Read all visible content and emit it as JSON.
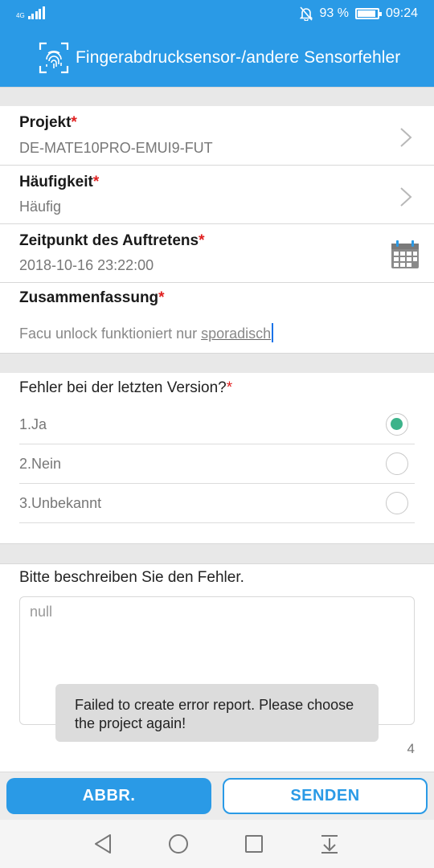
{
  "status_bar": {
    "network": "4G",
    "battery_percent": 93,
    "battery_text": "93 %",
    "time": "09:24",
    "icons": [
      "signal-icon",
      "mute-bell-icon",
      "battery-icon"
    ]
  },
  "header": {
    "title": "Fingerabdrucksensor-/andere Sensorfehler",
    "icon": "fingerprint-scan-icon"
  },
  "form": {
    "project": {
      "label": "Projekt",
      "required_mark": "*",
      "value": "DE-MATE10PRO-EMUI9-FUT"
    },
    "frequency": {
      "label": "Häufigkeit",
      "required_mark": "*",
      "value": "Häufig"
    },
    "occurrence": {
      "label": "Zeitpunkt des Auftretens",
      "required_mark": "*",
      "value": "2018-10-16 23:22:00"
    },
    "summary": {
      "label": "Zusammenfassung",
      "required_mark": "*",
      "value_plain": "Facu unlock funktioniert nur ",
      "value_underlined": "sporadisch"
    }
  },
  "question": {
    "title": "Fehler bei der letzten Version?",
    "required_mark": "*",
    "options": [
      {
        "label": "1.Ja",
        "selected": true
      },
      {
        "label": "2.Nein",
        "selected": false
      },
      {
        "label": "3.Unbekannt",
        "selected": false
      }
    ]
  },
  "description": {
    "label": "Bitte beschreiben Sie den Fehler.",
    "placeholder": "null",
    "counter": "4"
  },
  "toast": {
    "message": "Failed to create error report. Please choose the project again!"
  },
  "actions": {
    "cancel_label": "ABBR.",
    "send_label": "SENDEN"
  },
  "colors": {
    "accent": "#2a9ae6",
    "required": "#e02020",
    "radio_selected": "#3cb38a"
  }
}
